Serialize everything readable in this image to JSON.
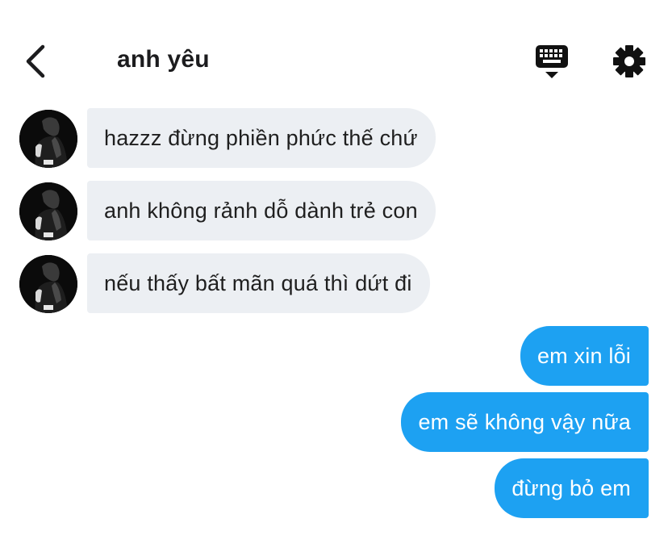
{
  "header": {
    "title": "anh yêu",
    "back_icon": "chevron-left-icon",
    "keyboard_icon": "keyboard-icon",
    "settings_icon": "gear-icon"
  },
  "messages": [
    {
      "from": "them",
      "text": "hazzz đừng phiền phức thế chứ"
    },
    {
      "from": "them",
      "text": "anh không rảnh dỗ dành trẻ con"
    },
    {
      "from": "them",
      "text": "nếu thấy bất mãn quá thì dứt đi"
    },
    {
      "from": "me",
      "text": "em xin lỗi"
    },
    {
      "from": "me",
      "text": "em sẽ không vậy nữa"
    },
    {
      "from": "me",
      "text": "đừng bỏ em"
    }
  ],
  "colors": {
    "incoming_bubble": "#eceff3",
    "outgoing_bubble": "#1da1f2",
    "incoming_text": "#1f1f1f",
    "outgoing_text": "#ffffff",
    "title_text": "#1c1c1e"
  }
}
